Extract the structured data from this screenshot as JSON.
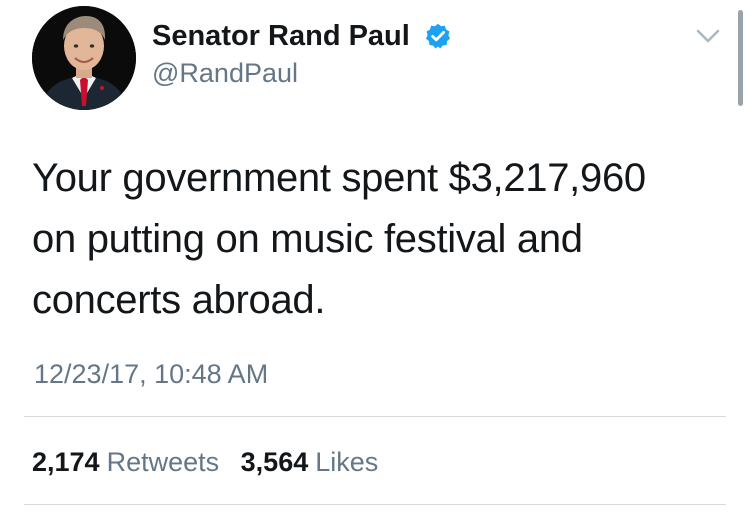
{
  "author": {
    "display_name": "Senator Rand Paul",
    "handle": "@RandPaul",
    "verified": true,
    "avatar_icon": "profile-photo"
  },
  "tweet": {
    "text_lines": [
      "Your government spent $3,217,960",
      "on putting on music festival and",
      "concerts abroad."
    ],
    "timestamp": "12/23/17, 10:48 AM"
  },
  "stats": {
    "retweets": {
      "count": "2,174",
      "label": "Retweets"
    },
    "likes": {
      "count": "3,564",
      "label": "Likes"
    }
  },
  "icons": {
    "verified": "verified-badge-icon",
    "menu": "chevron-down-icon"
  },
  "colors": {
    "text_primary": "#14171a",
    "text_secondary": "#657786",
    "verified_blue": "#1da1f2",
    "divider": "#d6dbdf"
  }
}
